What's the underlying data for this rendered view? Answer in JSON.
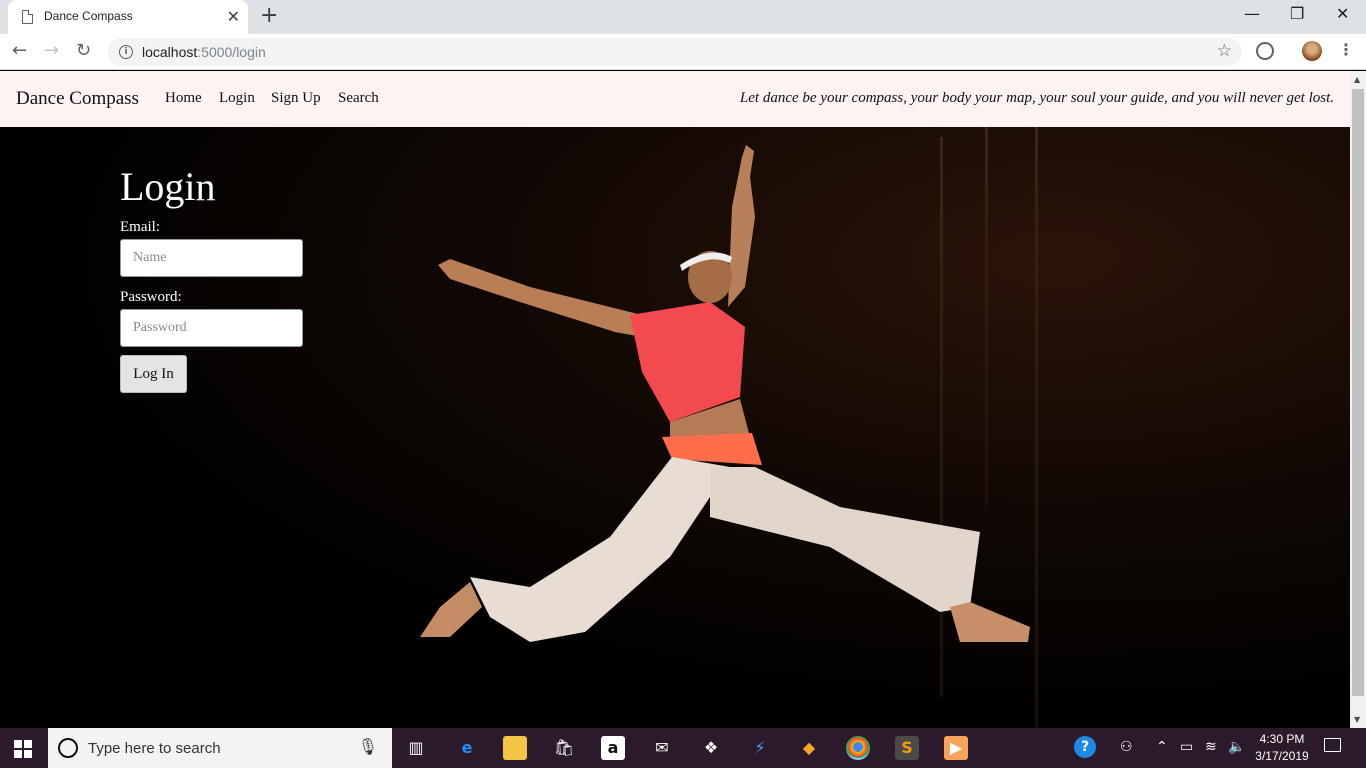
{
  "browser": {
    "tab_title": "Dance Compass",
    "url_host": "localhost",
    "url_path": ":5000/login",
    "new_tab": "+",
    "close_tab": "✕"
  },
  "site": {
    "brand": "Dance Compass",
    "nav": [
      "Home",
      "Login",
      "Sign Up",
      "Search"
    ],
    "tagline": "Let dance be your compass, your body your map, your soul your guide, and you will never get lost."
  },
  "login": {
    "title": "Login",
    "email_label": "Email:",
    "email_placeholder": "Name",
    "password_label": "Password:",
    "password_placeholder": "Password",
    "submit_label": "Log In"
  },
  "taskbar": {
    "search_placeholder": "Type here to search",
    "time": "4:30 PM",
    "date": "3/17/2019",
    "apps": [
      "task-view",
      "edge",
      "file-explorer",
      "store",
      "amazon",
      "mail",
      "dropbox",
      "visual-studio",
      "sourcetree",
      "chrome",
      "sublime-text",
      "media-player"
    ]
  },
  "colors": {
    "navbar_bg": "#fdf3f3",
    "page_bg": "#000000",
    "taskbar_bg": "#2b1a2a"
  }
}
